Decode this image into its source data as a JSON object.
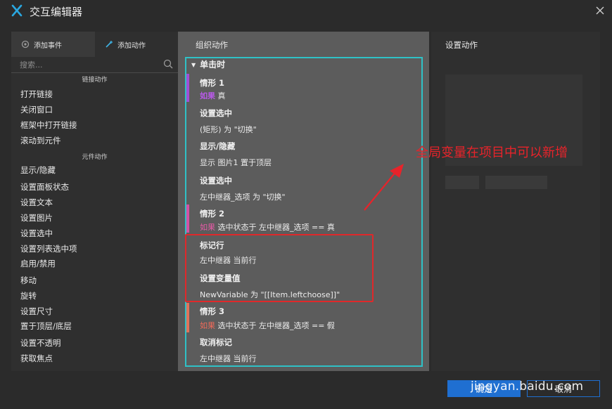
{
  "window": {
    "title": "交互编辑器"
  },
  "left": {
    "tab_events": "添加事件",
    "tab_actions": "添加动作",
    "search_placeholder": "搜索...",
    "link_section": "链接动作",
    "link_items": [
      "打开链接",
      "关闭窗口",
      "框架中打开链接",
      "滚动到元件"
    ],
    "widget_section": "元件动作",
    "widget_items": [
      "显示/隐藏",
      "设置面板状态",
      "设置文本",
      "设置图片",
      "设置选中",
      "设置列表选中项",
      "启用/禁用",
      "移动",
      "旋转",
      "设置尺寸",
      "置于顶层/底层",
      "设置不透明",
      "获取焦点"
    ]
  },
  "middle": {
    "title": "组织动作",
    "event": "单击时",
    "case1": {
      "name": "情形 1",
      "if": "如果",
      "cond": "真"
    },
    "a1": {
      "title": "设置选中",
      "desc": "(矩形) 为 \"切换\""
    },
    "a2": {
      "title": "显示/隐藏",
      "desc": "显示 图片1  置于顶层"
    },
    "a3": {
      "title": "设置选中",
      "desc": "左中继器_选项 为 \"切换\""
    },
    "case2": {
      "name": "情形 2",
      "if": "如果",
      "cond": "选中状态于 左中继器_选项 == 真"
    },
    "a4": {
      "title": "标记行",
      "desc": "左中继器 当前行"
    },
    "a5": {
      "title": "设置变量值",
      "desc": "NewVariable 为 \"[[Item.leftchoose]]\""
    },
    "case3": {
      "name": "情形 3",
      "if": "如果",
      "cond": "选中状态于 左中继器_选项 == 假"
    },
    "a6": {
      "title": "取消标记",
      "desc": "左中继器 当前行"
    }
  },
  "right": {
    "title": "设置动作"
  },
  "annotation": "全局变量在项目中可以新增",
  "footer": {
    "ok": "确定",
    "cancel": "取消"
  },
  "watermark": "jingyan.baidu.com",
  "colors": {
    "cyan_outline": "#2fc1c6",
    "red_outline": "#e0282a",
    "case1_bar": "#a24fd6",
    "case2_bar": "#d451a4",
    "case3_bar": "#e0735a",
    "primary_button": "#1f6fd1"
  }
}
